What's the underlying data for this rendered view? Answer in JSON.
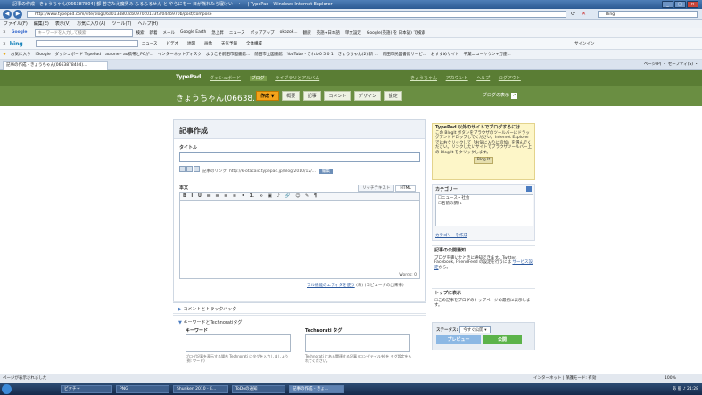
{
  "window": {
    "title": "記事の作成 - きょうちゃん(06638780​4) 都 若さたえ魔界み ふるふるせん と やらにをー 日が熊れたら寝けい・・・ | TypePad - Windows Internet Explorer"
  },
  "address": {
    "url": "http://www.typepad.com/site/blogs/6a0134803cb0970c0133f3f044b970b/post/compose",
    "search_placeholder": "Bing"
  },
  "menu": [
    "ファイル(F)",
    "編集(E)",
    "表示(V)",
    "お気に入り(A)",
    "ツール(T)",
    "ヘルプ(H)"
  ],
  "google_bar": {
    "label": "Google",
    "placeholder": "キーワードを入力して検索",
    "items": [
      "検索",
      "新着",
      "メール",
      "Google Earth",
      "急上昇",
      "ニュース",
      "ポップアップ",
      "okozok...",
      "翻訳",
      "英語→日本語",
      "単文設定",
      "Google(英語) を 日本語) で検索"
    ]
  },
  "bing_bar": {
    "label": "bing",
    "items": [
      "ニュース",
      "ビデオ",
      "地図",
      "画像",
      "天気予報",
      "全体構成",
      "サインイン"
    ]
  },
  "favorites": {
    "label": "お気に入り",
    "items": [
      "iGoogle",
      "ダッシュボード TypePad",
      "au one - au携帯とPCが...",
      "インターネットディスク",
      "ようこそ前田市図書館...",
      "前田市立図書館",
      "YouTube - きれい0 5 0 1",
      "きょうちゃん(2) 新 ...",
      "前田市民図書館サービ...",
      "おすすめサイト",
      "千葉ニューヤウン+万座..."
    ]
  },
  "tab": {
    "label": "記事の作成 - きょうちゃん(0663878404)..."
  },
  "tab_tools": "ページ(P) ・ セーフティ(S) ・",
  "typepad": {
    "logo": "TypePad",
    "nav": [
      "ダッシュボード",
      "ブログ",
      "ライブラリとアルバム"
    ],
    "right_links": [
      "きょうちゃん",
      "アカウント",
      "ヘルプ",
      "ログアウト"
    ],
    "blog_name": "きょうちゃん(06638...",
    "tabs": [
      "作成 ▼",
      "概要",
      "記事",
      "コメント",
      "デザイン",
      "設定"
    ],
    "view_blog": "ブログの表示"
  },
  "compose": {
    "heading": "記事作成",
    "title_label": "タイトル",
    "permalink": "記事のリンク: http://k-otacaic.typepad.jp/blog/2010/12/...",
    "permalink_edit": "編集",
    "body_label": "本文",
    "editor_tabs": [
      "リッチテキスト",
      "HTML"
    ],
    "toolbar": [
      "B",
      "I",
      "U",
      "≡",
      "≡",
      "≡",
      "≡",
      "•",
      "1.",
      "∞",
      "▣",
      "♪",
      "🔗",
      "☺",
      "✎",
      "¶"
    ],
    "word_count": "Words: 0",
    "rich_note_link": "フル機能のエディタを使う",
    "rich_note_tail": "(表) (コピュータの出来事)"
  },
  "sections": {
    "trackback": "コメントとトラックバック",
    "tags": "キーワードとTechnoratiタグ",
    "keyword_label": "キーワード",
    "technorati_label": "Technorati タグ",
    "keyword_hint": "ブログ記事を表示する場合 Technorati にタグを入力しましょう (例: ワード)",
    "technorati_hint": "Technorati にある関連する記事 (ロングテイルを)を タグ設定を入れてください。"
  },
  "sidebar": {
    "ext_title": "TypePad 以外のサイトでブログするには",
    "ext_body": "この BlogIt ボタンをブラウザのツールバーにドラッグアンドドロップしてください。Internet Explorer では右クリックして「お気に入りに追加」を選んでください。リンクしたいサイトでブラウザツールバー上の Blog It をクリックします。",
    "blogit": "Blog It",
    "category_title": "カテゴリー",
    "categories": [
      "ニュース・社会",
      "名前の謂れ"
    ],
    "category_manage": "カテゴリーを作成",
    "notify_title": "記事の公開通知",
    "notify_body": "ブログを書いたときに通知できます。Twitter, Facebook, FriendFeed の設定を行うには",
    "notify_link": "サービス設定",
    "notify_tail": "から。",
    "top_title": "トップに表示",
    "top_body": "この記事をブログのトップページの最初に表示します。",
    "status_label": "ステータス:",
    "status_value": "今すぐ公開",
    "preview": "プレビュー",
    "publish": "公開"
  },
  "statusbar": {
    "left": "ページが表示されました",
    "zone": "インターネット | 保護モード: 有効",
    "zoom": "100%"
  },
  "taskbar": {
    "tasks": [
      "ピクチャ",
      "PNG",
      "Shuriken 2010 - E...",
      "ToDoの通知",
      "記事の作成 - きょ..."
    ],
    "tray": "あ 般 ♪ 21:28"
  }
}
